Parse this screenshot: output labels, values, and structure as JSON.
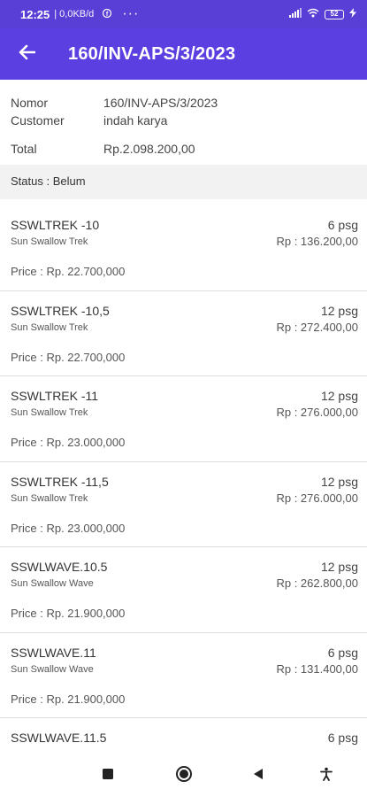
{
  "status_bar": {
    "time": "12:25",
    "net_speed": "| 0,0KB/d",
    "battery": "52",
    "icons": [
      "signal-icon",
      "wifi-icon",
      "battery-icon",
      "charging-icon"
    ]
  },
  "app_bar": {
    "title": "160/INV-APS/3/2023",
    "color": "#5b3fe0"
  },
  "invoice": {
    "nomor_label": "Nomor",
    "nomor_value": "160/INV-APS/3/2023",
    "customer_label": "Customer",
    "customer_value": "indah karya",
    "total_label": "Total",
    "total_value": "Rp.2.098.200,00"
  },
  "status": {
    "text": "Status : Belum"
  },
  "items": [
    {
      "code": "SSWLTREK -10",
      "name": "Sun Swallow Trek",
      "qty": "6 psg",
      "amount": "Rp : 136.200,00",
      "price": "Price : Rp. 22.700,000"
    },
    {
      "code": "SSWLTREK -10,5",
      "name": "Sun Swallow Trek",
      "qty": "12 psg",
      "amount": "Rp : 272.400,00",
      "price": "Price : Rp. 22.700,000"
    },
    {
      "code": "SSWLTREK -11",
      "name": "Sun Swallow Trek",
      "qty": "12 psg",
      "amount": "Rp : 276.000,00",
      "price": "Price : Rp. 23.000,000"
    },
    {
      "code": "SSWLTREK -11,5",
      "name": "Sun Swallow Trek",
      "qty": "12 psg",
      "amount": "Rp : 276.000,00",
      "price": "Price : Rp. 23.000,000"
    },
    {
      "code": "SSWLWAVE.10.5",
      "name": "Sun Swallow Wave",
      "qty": "12 psg",
      "amount": "Rp : 262.800,00",
      "price": "Price : Rp. 21.900,000"
    },
    {
      "code": "SSWLWAVE.11",
      "name": "Sun Swallow Wave",
      "qty": "6 psg",
      "amount": "Rp : 131.400,00",
      "price": "Price : Rp. 21.900,000"
    },
    {
      "code": "SSWLWAVE.11.5",
      "name": "",
      "qty": "6 psg",
      "amount": "",
      "price": ""
    }
  ],
  "nav_bar": {
    "buttons": [
      "recents-icon",
      "home-icon",
      "back-icon",
      "accessibility-icon"
    ]
  }
}
